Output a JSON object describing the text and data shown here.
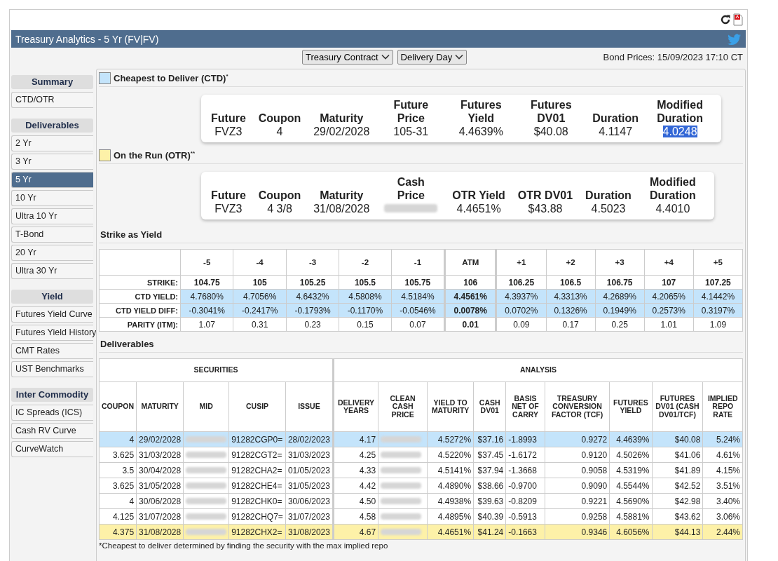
{
  "title": "Treasury Analytics - 5 Yr (FV|FV)",
  "dropdowns": [
    "Treasury Contract",
    "Delivery Day"
  ],
  "bond_prices": "Bond Prices: 15/09/2023 17:10 CT",
  "sidebar": [
    {
      "heading": "Summary",
      "items": [
        {
          "label": "CTD/OTR",
          "selected": false
        }
      ]
    },
    {
      "heading": "Deliverables",
      "items": [
        {
          "label": "2 Yr",
          "selected": false
        },
        {
          "label": "3 Yr",
          "selected": false
        },
        {
          "label": "5 Yr",
          "selected": true
        },
        {
          "label": "10 Yr",
          "selected": false
        },
        {
          "label": "Ultra 10 Yr",
          "selected": false
        },
        {
          "label": "T-Bond",
          "selected": false
        },
        {
          "label": "20 Yr",
          "selected": false
        },
        {
          "label": "Ultra 30 Yr",
          "selected": false
        }
      ]
    },
    {
      "heading": "Yield",
      "items": [
        {
          "label": "Futures Yield Curve",
          "selected": false
        },
        {
          "label": "Futures Yield History",
          "selected": false
        },
        {
          "label": "CMT Rates",
          "selected": false
        },
        {
          "label": "UST Benchmarks",
          "selected": false
        }
      ]
    },
    {
      "heading": "Inter Commodity",
      "items": [
        {
          "label": "IC Spreads (ICS)",
          "selected": false
        },
        {
          "label": "Cash RV Curve",
          "selected": false
        },
        {
          "label": "CurveWatch",
          "selected": false
        }
      ]
    }
  ],
  "summaries": [
    {
      "title": "Cheapest to Deliver (CTD)$^{*}$",
      "color": "#c4e4fb",
      "fields": [
        {
          "label": "Future",
          "value": "FVZ3",
          "redacted": false,
          "highlighted": false
        },
        {
          "label": "Coupon",
          "value": "4",
          "redacted": false,
          "highlighted": false
        },
        {
          "label": "Maturity",
          "value": "29/02/2028",
          "redacted": false,
          "highlighted": false
        },
        {
          "label": "Future Price",
          "value": "105-31",
          "redacted": false,
          "highlighted": false
        },
        {
          "label": "Futures Yield",
          "value": "4.4639%",
          "redacted": false,
          "highlighted": false
        },
        {
          "label": "Futures DV01",
          "value": "$40.08",
          "redacted": false,
          "highlighted": false
        },
        {
          "label": "Duration",
          "value": "4.1147",
          "redacted": false,
          "highlighted": false
        },
        {
          "label": "Modified Duration",
          "value": "4.0248",
          "redacted": false,
          "highlighted": true
        }
      ]
    },
    {
      "title": "On the Run (OTR)$^{**}$",
      "color": "#fdf1a8",
      "fields": [
        {
          "label": "Future",
          "value": "FVZ3",
          "redacted": false,
          "highlighted": false
        },
        {
          "label": "Coupon",
          "value": "4 3/8",
          "redacted": false,
          "highlighted": false
        },
        {
          "label": "Maturity",
          "value": "31/08/2028",
          "redacted": false,
          "highlighted": false
        },
        {
          "label": "Cash Price",
          "redacted": true,
          "highlighted": false
        },
        {
          "label": "OTR Yield",
          "value": "4.4651%",
          "redacted": false,
          "highlighted": false
        },
        {
          "label": "OTR DV01",
          "value": "$43.88",
          "redacted": false,
          "highlighted": false
        },
        {
          "label": "Duration",
          "value": "4.5023",
          "redacted": false,
          "highlighted": false
        },
        {
          "label": "Modified Duration",
          "value": "4.4010",
          "redacted": false,
          "highlighted": false
        }
      ]
    }
  ],
  "strike": {
    "title": "Strike as Yield",
    "columns": [
      {
        "label": "-5",
        "atm": false
      },
      {
        "label": "-4",
        "atm": false
      },
      {
        "label": "-3",
        "atm": false
      },
      {
        "label": "-2",
        "atm": false
      },
      {
        "label": "-1",
        "atm": false
      },
      {
        "label": "ATM",
        "atm": true
      },
      {
        "label": "+1",
        "atm": false
      },
      {
        "label": "+2",
        "atm": false
      },
      {
        "label": "+3",
        "atm": false
      },
      {
        "label": "+4",
        "atm": false
      },
      {
        "label": "+5",
        "atm": false
      }
    ],
    "rows": [
      {
        "label": "STRIKE:",
        "bold": true,
        "highlighted": false,
        "cells": [
          "104.75",
          "105",
          "105.25",
          "105.5",
          "105.75",
          "106",
          "106.25",
          "106.5",
          "106.75",
          "107",
          "107.25"
        ]
      },
      {
        "label": "CTD YIELD:",
        "bold": false,
        "highlighted": true,
        "cells": [
          "4.7680%",
          "4.7056%",
          "4.6432%",
          "4.5808%",
          "4.5184%",
          "4.4561%",
          "4.3937%",
          "4.3313%",
          "4.2689%",
          "4.2065%",
          "4.1442%"
        ]
      },
      {
        "label": "CTD YIELD DIFF:",
        "bold": false,
        "highlighted": true,
        "cells": [
          "-0.3041%",
          "-0.2417%",
          "-0.1793%",
          "-0.1170%",
          "-0.0546%",
          "0.0078%",
          "0.0702%",
          "0.1326%",
          "0.1949%",
          "0.2573%",
          "0.3197%"
        ]
      },
      {
        "label": "PARITY (ITM):",
        "bold": false,
        "highlighted": false,
        "cells": [
          "1.07",
          "0.31",
          "0.23",
          "0.15",
          "0.07",
          "0.01",
          "0.09",
          "0.17",
          "0.25",
          "1.01",
          "1.09"
        ]
      }
    ]
  },
  "deliverables": {
    "title": "Deliverables",
    "groups": [
      {
        "label": "SECURITIES",
        "columns": [
          "COUPON",
          "MATURITY",
          "MID",
          "CUSIP",
          "ISSUE"
        ]
      },
      {
        "label": "ANALYSIS",
        "columns": [
          "DELIVERY YEARS",
          "CLEAN CASH PRICE",
          "YIELD TO MATURITY",
          "CASH DV01",
          "BASIS NET OF CARRY",
          "TREASURY CONVERSION FACTOR (TCF)",
          "FUTURES YIELD",
          "FUTURES DV01 (CASH DV01/TCF)",
          "IMPLIED REPO RATE"
        ]
      }
    ],
    "rows": [
      {
        "ctd": true,
        "otr": false,
        "cells": [
          "4",
          "29/02/2028",
          null,
          "91282CGP0=",
          "28/02/2023",
          "4.17",
          null,
          "4.5272%",
          "$37.16",
          "-1.8993",
          "0.9272",
          "4.4639%",
          "$40.08",
          "5.24%"
        ]
      },
      {
        "ctd": false,
        "otr": false,
        "cells": [
          "3.625",
          "31/03/2028",
          null,
          "91282CGT2=",
          "31/03/2023",
          "4.25",
          null,
          "4.5220%",
          "$37.45",
          "-1.6172",
          "0.9120",
          "4.5026%",
          "$41.06",
          "4.61%"
        ]
      },
      {
        "ctd": false,
        "otr": false,
        "cells": [
          "3.5",
          "30/04/2028",
          null,
          "91282CHA2=",
          "01/05/2023",
          "4.33",
          null,
          "4.5141%",
          "$37.94",
          "-1.3668",
          "0.9058",
          "4.5319%",
          "$41.89",
          "4.15%"
        ]
      },
      {
        "ctd": false,
        "otr": false,
        "cells": [
          "3.625",
          "31/05/2028",
          null,
          "91282CHE4=",
          "31/05/2023",
          "4.42",
          null,
          "4.4890%",
          "$38.66",
          "-0.9700",
          "0.9090",
          "4.5544%",
          "$42.52",
          "3.51%"
        ]
      },
      {
        "ctd": false,
        "otr": false,
        "cells": [
          "4",
          "30/06/2028",
          null,
          "91282CHK0=",
          "30/06/2023",
          "4.50",
          null,
          "4.4938%",
          "$39.63",
          "-0.8209",
          "0.9221",
          "4.5690%",
          "$42.98",
          "3.40%"
        ]
      },
      {
        "ctd": false,
        "otr": false,
        "cells": [
          "4.125",
          "31/07/2028",
          null,
          "91282CHQ7=",
          "31/07/2023",
          "4.58",
          null,
          "4.4895%",
          "$40.39",
          "-0.5913",
          "0.9258",
          "4.5881%",
          "$43.62",
          "3.06%"
        ]
      },
      {
        "ctd": false,
        "otr": true,
        "cells": [
          "4.375",
          "31/08/2028",
          null,
          "91282CHX2=",
          "31/08/2023",
          "4.67",
          null,
          "4.4651%",
          "$41.24",
          "-0.1663",
          "0.9346",
          "4.6056%",
          "$44.13",
          "2.44%"
        ]
      }
    ],
    "footnote": "*Cheapest to deliver determined by finding the security with the max implied repo"
  }
}
